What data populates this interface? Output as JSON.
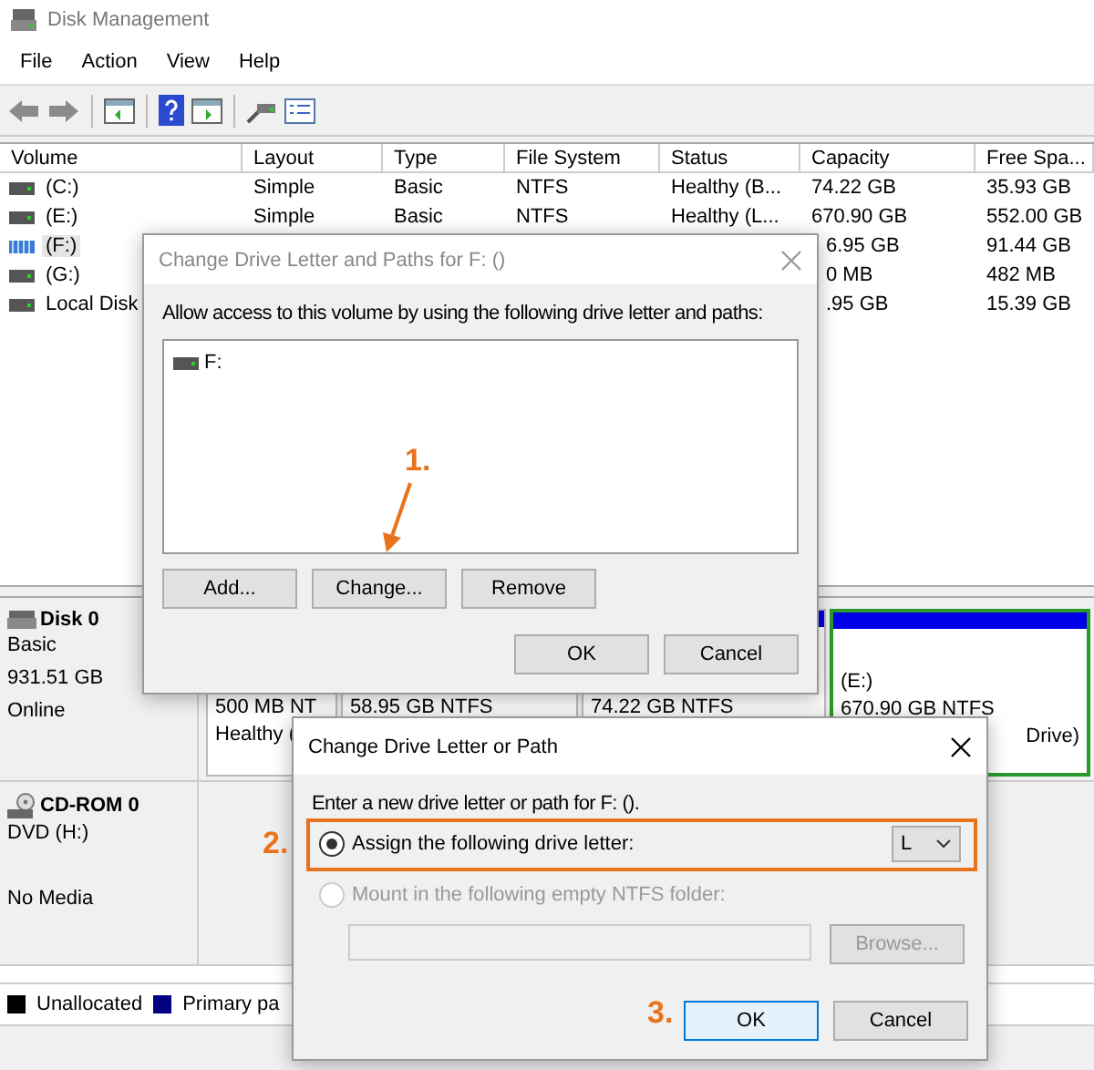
{
  "window": {
    "title": "Disk Management"
  },
  "menu": [
    "File",
    "Action",
    "View",
    "Help"
  ],
  "volumes": {
    "columns": [
      "Volume",
      "Layout",
      "Type",
      "File System",
      "Status",
      "Capacity",
      "Free Spa..."
    ],
    "rows": [
      {
        "volume": "(C:)",
        "layout": "Simple",
        "type": "Basic",
        "file_system": "NTFS",
        "status": "Healthy (B...",
        "capacity": "74.22 GB",
        "free_space": "35.93 GB",
        "selected": false,
        "kind": "plain"
      },
      {
        "volume": "(E:)",
        "layout": "Simple",
        "type": "Basic",
        "file_system": "NTFS",
        "status": "Healthy (L...",
        "capacity": "670.90 GB",
        "free_space": "552.00 GB",
        "selected": false,
        "kind": "plain"
      },
      {
        "volume": "(F:)",
        "capacity": "6.95 GB",
        "free_space": "91.44 GB",
        "selected": true,
        "kind": "striped"
      },
      {
        "volume": "(G:)",
        "capacity": "0 MB",
        "free_space": "482 MB",
        "selected": false,
        "kind": "plain"
      },
      {
        "volume": "Local Disk",
        "capacity": ".95 GB",
        "free_space": "15.39 GB",
        "selected": false,
        "kind": "plain"
      }
    ]
  },
  "disks": [
    {
      "name": "Disk 0",
      "kind": "disk",
      "type": "Basic",
      "size": "931.51 GB",
      "status": "Online",
      "partitions": [
        {
          "size": "500 MB NT",
          "status": "Healthy ("
        },
        {
          "size": "58.95 GB NTFS"
        },
        {
          "size": "74.22 GB NTFS"
        },
        {
          "name": "(E:)",
          "size": "670.90 GB NTFS",
          "status": "Drive)"
        }
      ]
    },
    {
      "name": "CD-ROM 0",
      "kind": "cdrom",
      "type": "DVD (H:)",
      "status": "No Media"
    }
  ],
  "legend": [
    {
      "label": "Unallocated",
      "color": "#000000"
    },
    {
      "label": "Primary pa",
      "color": "#000080"
    }
  ],
  "paths_dialog": {
    "title": "Change Drive Letter and Paths for F: ()",
    "active": false,
    "prompt": "Allow access to this volume by using the following drive letter and paths:",
    "entries": [
      {
        "label": "F:"
      }
    ],
    "buttons": [
      "Add...",
      "Change...",
      "Remove"
    ],
    "footer_buttons": [
      "OK",
      "Cancel"
    ]
  },
  "change_dialog": {
    "title": "Change Drive Letter or Path",
    "active": true,
    "prompt": "Enter a new drive letter or path for F: ().",
    "options": [
      {
        "kind": "letter",
        "label": "Assign the following drive letter:",
        "selected": true,
        "disabled": false,
        "value": "L"
      },
      {
        "kind": "folder",
        "label": "Mount in the following empty NTFS folder:",
        "selected": false,
        "disabled": true,
        "button": "Browse..."
      }
    ],
    "buttons": [
      {
        "label": "OK",
        "focused": true
      },
      {
        "label": "Cancel",
        "focused": false
      }
    ]
  },
  "annotations": [
    {
      "kind": "arrow",
      "label": "1."
    },
    {
      "kind": "frame",
      "label": "2."
    },
    {
      "kind": "plain",
      "label": "3."
    }
  ]
}
